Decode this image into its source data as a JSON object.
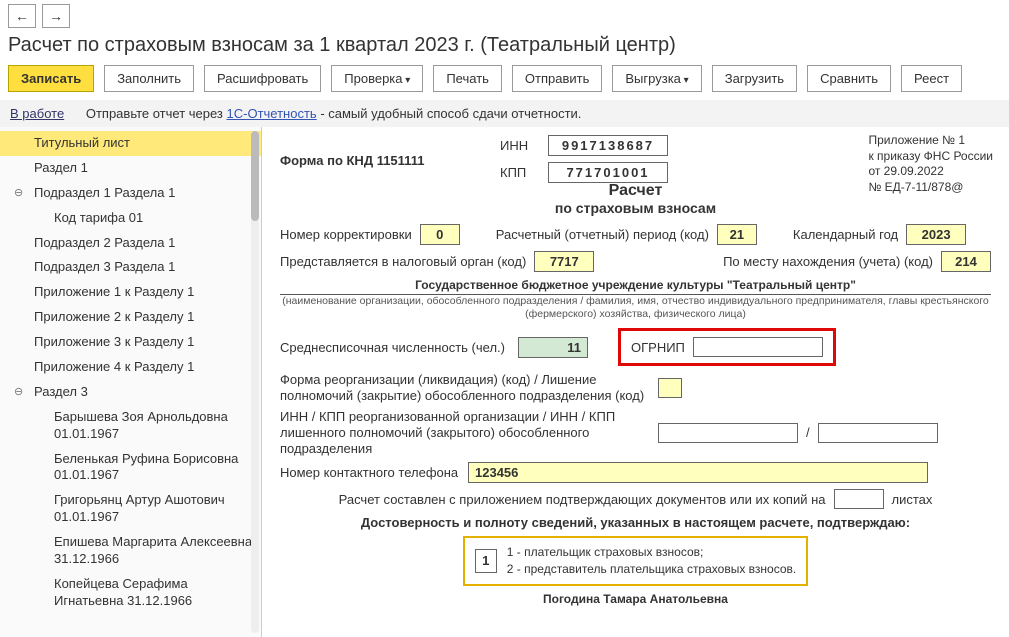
{
  "nav": {
    "back": "←",
    "fwd": "→"
  },
  "title": "Расчет по страховым взносам за 1 квартал 2023 г. (Театральный центр)",
  "toolbar": {
    "write": "Записать",
    "fill": "Заполнить",
    "decode": "Расшифровать",
    "check": "Проверка",
    "print": "Печать",
    "send": "Отправить",
    "upload": "Выгрузка",
    "load": "Загрузить",
    "compare": "Сравнить",
    "regs": "Реест"
  },
  "status": {
    "label": "В работе",
    "prefix": "Отправьте отчет через ",
    "link": "1С-Отчетность",
    "suffix": " - самый удобный способ сдачи отчетности."
  },
  "tree": {
    "title_page": "Титульный лист",
    "sec1": "Раздел 1",
    "sub1_1": "Подраздел 1 Раздела 1",
    "tariff": "Код тарифа 01",
    "sub1_2": "Подраздел 2 Раздела 1",
    "sub1_3": "Подраздел 3 Раздела 1",
    "app1": "Приложение 1 к Разделу 1",
    "app2": "Приложение 2 к Разделу 1",
    "app3": "Приложение 3 к Разделу 1",
    "app4": "Приложение 4 к Разделу 1",
    "sec3": "Раздел 3",
    "p1": "Барышева Зоя Арнольдовна 01.01.1967",
    "p2": "Беленькая Руфина Борисовна 01.01.1967",
    "p3": "Григорьянц Артур Ашотович 01.01.1967",
    "p4": "Епишева Маргарита Алексеевна 31.12.1966",
    "p5": "Копейцева Серафима Игнатьевна 31.12.1966"
  },
  "form": {
    "inn_lbl": "ИНН",
    "inn": "9917138687",
    "kpp_lbl": "КПП",
    "kpp": "771701001",
    "knd": "Форма по КНД 1151111",
    "app_box": {
      "l1": "Приложение № 1",
      "l2": "к приказу ФНС России",
      "l3": "от 29.09.2022",
      "l4": "№ ЕД-7-11/878@"
    },
    "big_title": "Расчет",
    "sub_title": "по страховым взносам",
    "corr_lbl": "Номер корректировки",
    "corr": "0",
    "period_lbl": "Расчетный (отчетный) период (код)",
    "period": "21",
    "year_lbl": "Календарный год",
    "year": "2023",
    "tax_lbl": "Представляется в налоговый орган (код)",
    "tax": "7717",
    "place_lbl": "По месту нахождения (учета) (код)",
    "place": "214",
    "org": "Государственное бюджетное учреждение культуры \"Театральный центр\"",
    "org_note": "(наименование организации, обособленного подразделения / фамилия, имя, отчество индивидуального предпринимателя, главы крестьянского (фермерского) хозяйства, физического лица)",
    "avg_lbl": "Среднесписочная численность (чел.)",
    "avg": "11",
    "ogrnip_lbl": "ОГРНИП",
    "ogrnip": "",
    "reorg_lbl": "Форма реорганизации (ликвидация) (код) / Лишение полномочий (закрытие) обособленного подразделения (код)",
    "reorg": "",
    "inn_re_lbl": "ИНН / КПП реорганизованной организации / ИНН / КПП лишенного полномочий (закрытого) обособленного подразделения",
    "inn_re1": "",
    "inn_re_sep": "/",
    "inn_re2": "",
    "phone_lbl": "Номер контактного телефона",
    "phone": "123456",
    "docs_lbl1": "Расчет составлен с приложением подтверждающих документов или их копий на",
    "docs_val": "",
    "docs_lbl2": "листах",
    "confirm_title": "Достоверность и полноту сведений, указанных в настоящем расчете, подтверждаю:",
    "confirm_code": "1",
    "confirm_opt1": "1 - плательщик страховых взносов;",
    "confirm_opt2": "2 - представитель плательщика страховых взносов.",
    "signer": "Погодина Тамара Анатольевна"
  }
}
